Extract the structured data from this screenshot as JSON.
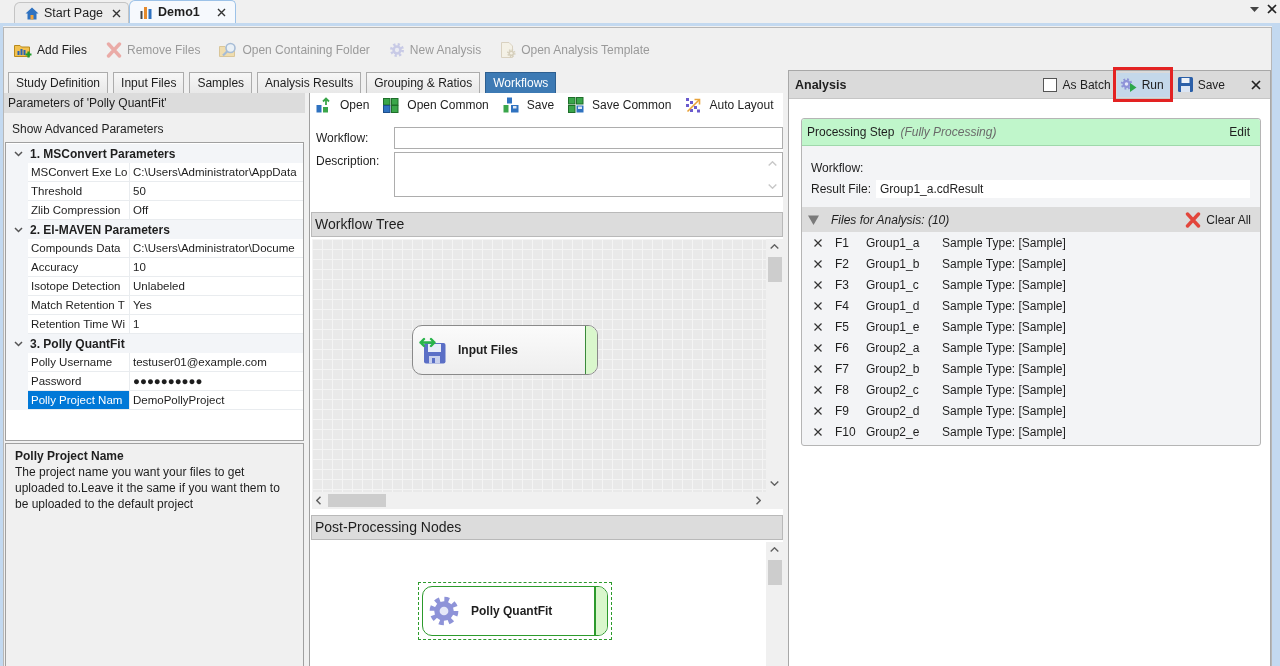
{
  "document_tabs": [
    {
      "label": "Start Page",
      "kind": "start",
      "selected": false
    },
    {
      "label": "Demo1",
      "kind": "study",
      "selected": true
    }
  ],
  "toolbar": [
    {
      "label": "Add Files",
      "kind": "add",
      "disabled": false
    },
    {
      "label": "Remove Files",
      "kind": "remove",
      "disabled": true
    },
    {
      "label": "Open Containing Folder",
      "kind": "folder",
      "disabled": true
    },
    {
      "label": "New Analysis",
      "kind": "analysis",
      "disabled": true
    },
    {
      "label": "Open Analysis Template",
      "kind": "template",
      "disabled": true
    }
  ],
  "view_tabs": [
    {
      "label": "Study Definition",
      "selected": false
    },
    {
      "label": "Input Files",
      "selected": false
    },
    {
      "label": "Samples",
      "selected": false
    },
    {
      "label": "Analysis Results",
      "selected": false
    },
    {
      "label": "Grouping & Ratios",
      "selected": false
    },
    {
      "label": "Workflows",
      "selected": true
    }
  ],
  "parameters": {
    "title": "Parameters of 'Polly QuantFit'",
    "advanced_button": "Show Advanced Parameters",
    "categories": [
      {
        "label": "1. MSConvert Parameters",
        "expanded": true,
        "properties": [
          {
            "name": "MSConvert Exe Lo",
            "value": "C:\\Users\\Administrator\\AppData",
            "selected": false
          },
          {
            "name": "Threshold",
            "value": "50",
            "selected": false
          },
          {
            "name": "Zlib Compression",
            "value": "Off",
            "selected": false
          }
        ]
      },
      {
        "label": "2. El-MAVEN Parameters",
        "expanded": true,
        "properties": [
          {
            "name": "Compounds Data",
            "value": "C:\\Users\\Administrator\\Docume",
            "selected": false
          },
          {
            "name": "Accuracy",
            "value": "10",
            "selected": false
          },
          {
            "name": "Isotope Detection",
            "value": "Unlabeled",
            "selected": false
          },
          {
            "name": "Match Retention T",
            "value": "Yes",
            "selected": false
          },
          {
            "name": "Retention Time Wi",
            "value": "1",
            "selected": false
          }
        ]
      },
      {
        "label": "3. Polly QuantFit",
        "expanded": true,
        "properties": [
          {
            "name": "Polly Username",
            "value": "testuser01@example.com",
            "selected": false
          },
          {
            "name": "Password",
            "value": "●●●●●●●●●●",
            "selected": false
          },
          {
            "name": "Polly Project Nam",
            "value": "DemoPollyProject",
            "selected": true
          }
        ]
      }
    ],
    "help": {
      "title": "Polly Project Name",
      "text": "The project name you want your files to get uploaded to.Leave it the same if you want them to be uploaded to the default project"
    }
  },
  "workflow_editor": {
    "toolbar": [
      {
        "label": "Open",
        "kind": "open"
      },
      {
        "label": "Open Common",
        "kind": "opencommon"
      },
      {
        "label": "Save",
        "kind": "save"
      },
      {
        "label": "Save Common",
        "kind": "savecommon"
      },
      {
        "label": "Auto Layout",
        "kind": "layout"
      }
    ],
    "workflow_label": "Workflow:",
    "description_label": "Description:",
    "tree": {
      "title": "Workflow Tree",
      "nodes": [
        {
          "label": "Input Files",
          "kind": "input",
          "selected": false
        }
      ]
    },
    "post_processing": {
      "title": "Post-Processing Nodes",
      "nodes": [
        {
          "label": "Polly QuantFit",
          "kind": "gear",
          "selected": true
        }
      ]
    }
  },
  "analysis": {
    "title": "Analysis",
    "as_batch": {
      "label": "As Batch",
      "checked": false
    },
    "run": {
      "label": "Run",
      "highlighted": true,
      "annotated": true
    },
    "save": "Save",
    "step": {
      "title": "Processing Step",
      "mode": "(Fully Processing)",
      "edit": "Edit",
      "workflow_label": "Workflow:",
      "result_label": "Result File:",
      "result_value": "Group1_a.cdResult"
    },
    "files": {
      "title": "Files for Analysis: (10)",
      "expanded": true,
      "clear_all": "Clear All",
      "rows": [
        {
          "id": "F1",
          "name": "Group1_a",
          "type": "Sample Type: [Sample]"
        },
        {
          "id": "F2",
          "name": "Group1_b",
          "type": "Sample Type: [Sample]"
        },
        {
          "id": "F3",
          "name": "Group1_c",
          "type": "Sample Type: [Sample]"
        },
        {
          "id": "F4",
          "name": "Group1_d",
          "type": "Sample Type: [Sample]"
        },
        {
          "id": "F5",
          "name": "Group1_e",
          "type": "Sample Type: [Sample]"
        },
        {
          "id": "F6",
          "name": "Group2_a",
          "type": "Sample Type: [Sample]"
        },
        {
          "id": "F7",
          "name": "Group2_b",
          "type": "Sample Type: [Sample]"
        },
        {
          "id": "F8",
          "name": "Group2_c",
          "type": "Sample Type: [Sample]"
        },
        {
          "id": "F9",
          "name": "Group2_d",
          "type": "Sample Type: [Sample]"
        },
        {
          "id": "F10",
          "name": "Group2_e",
          "type": "Sample Type: [Sample]"
        }
      ]
    }
  }
}
